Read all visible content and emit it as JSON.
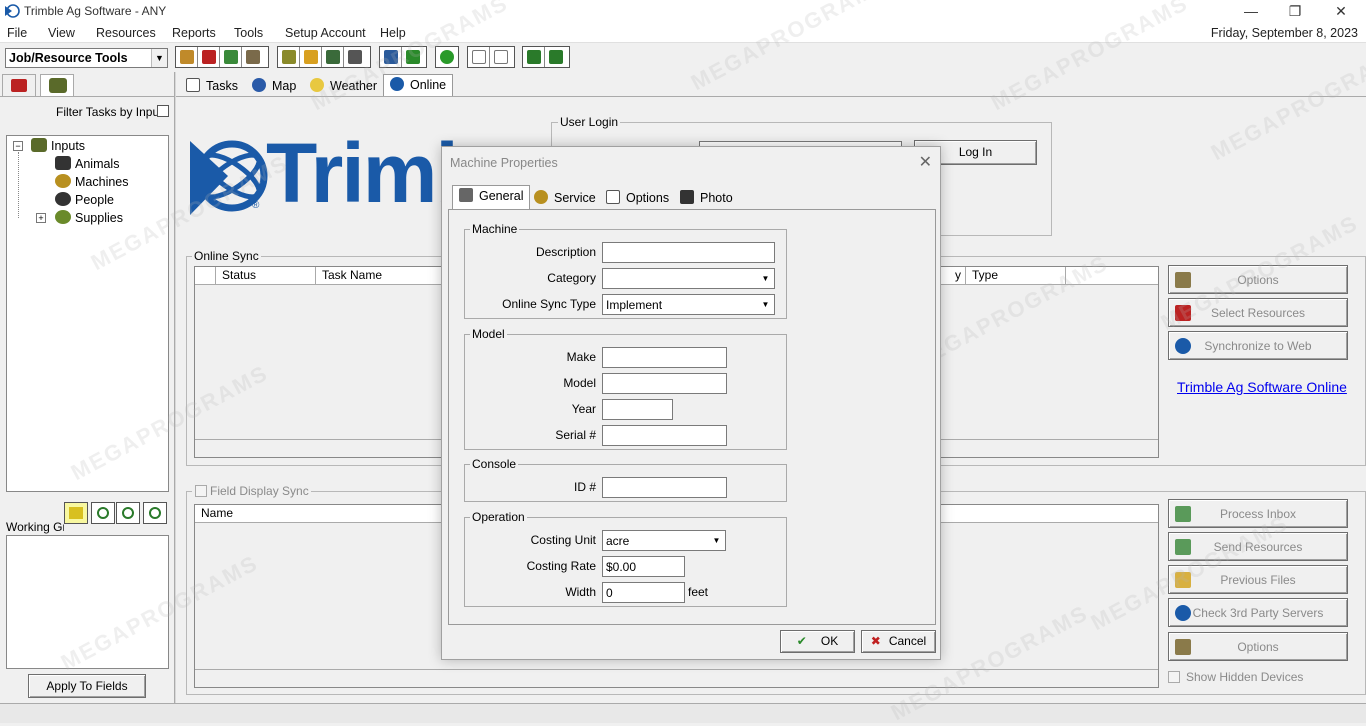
{
  "window": {
    "title": "Trimble Ag Software - ANY",
    "date": "Friday, September 8, 2023",
    "minimize_glyph": "—",
    "maximize_glyph": "❐",
    "close_glyph": "✕"
  },
  "menu": [
    "File",
    "View",
    "Resources",
    "Reports",
    "Tools",
    "Setup Account",
    "Help"
  ],
  "toolbar": {
    "mode_select": "Job/Resource Tools",
    "mode_arrow": "▼",
    "button_colors": [
      "#c08a2a",
      "#b22",
      "#3a8a3a",
      "#7a6a4a",
      "#8a8a2a",
      "#d8a020",
      "#3a6a3a",
      "#555",
      "#2a5a9a",
      "#2a8a2a",
      "#2a9a2a",
      "#777",
      "#777",
      "#2a7a2a",
      "#2a7a2a"
    ]
  },
  "left_panel": {
    "filter_label": "Filter Tasks by Input",
    "tree": {
      "root": "Inputs",
      "children": [
        "Animals",
        "Machines",
        "People",
        "Supplies"
      ],
      "expander_minus": "−",
      "expander_plus": "+"
    },
    "working_group_label": "Working Gro",
    "apply_button": "Apply To Fields"
  },
  "main_tabs": [
    "Tasks",
    "Map",
    "Weather",
    "Online"
  ],
  "brand": {
    "logo_text": "Trimb",
    "brand_color": "#1a5aa8",
    "registered_mark": "®"
  },
  "login": {
    "group_label": "User Login",
    "login_button": "Log In"
  },
  "online_sync": {
    "label": "Online Sync",
    "columns": [
      "Status",
      "Task Name",
      "y",
      "Type"
    ]
  },
  "side_buttons_top": [
    "Options",
    "Select Resources",
    "Synchronize to Web"
  ],
  "online_link": "Trimble Ag Software Online",
  "field_display": {
    "label": "Field Display Sync",
    "columns": [
      "Name"
    ]
  },
  "side_buttons_bottom": [
    "Process Inbox",
    "Send Resources",
    "Previous Files",
    "Check 3rd Party Servers",
    "Options"
  ],
  "show_hidden_label": "Show Hidden Devices",
  "dialog": {
    "title": "Machine Properties",
    "close_glyph": "✕",
    "tabs": [
      "General",
      "Service",
      "Options",
      "Photo"
    ],
    "machine": {
      "group": "Machine",
      "description_label": "Description",
      "description_value": "",
      "category_label": "Category",
      "category_value": "",
      "sync_type_label": "Online Sync Type",
      "sync_type_value": "Implement"
    },
    "model": {
      "group": "Model",
      "make_label": "Make",
      "model_label": "Model",
      "year_label": "Year",
      "serial_label": "Serial #"
    },
    "console": {
      "group": "Console",
      "id_label": "ID #"
    },
    "operation": {
      "group": "Operation",
      "costing_unit_label": "Costing Unit",
      "costing_unit_value": "acre",
      "costing_rate_label": "Costing Rate",
      "costing_rate_value": "$0.00",
      "width_label": "Width",
      "width_value": "0",
      "width_unit": "feet"
    },
    "ok_button": "OK",
    "cancel_button": "Cancel",
    "ok_glyph": "✔",
    "cancel_glyph": "✖",
    "dropdown_arrow": "▼"
  },
  "watermark_text": "MEGAPROGRAMS"
}
